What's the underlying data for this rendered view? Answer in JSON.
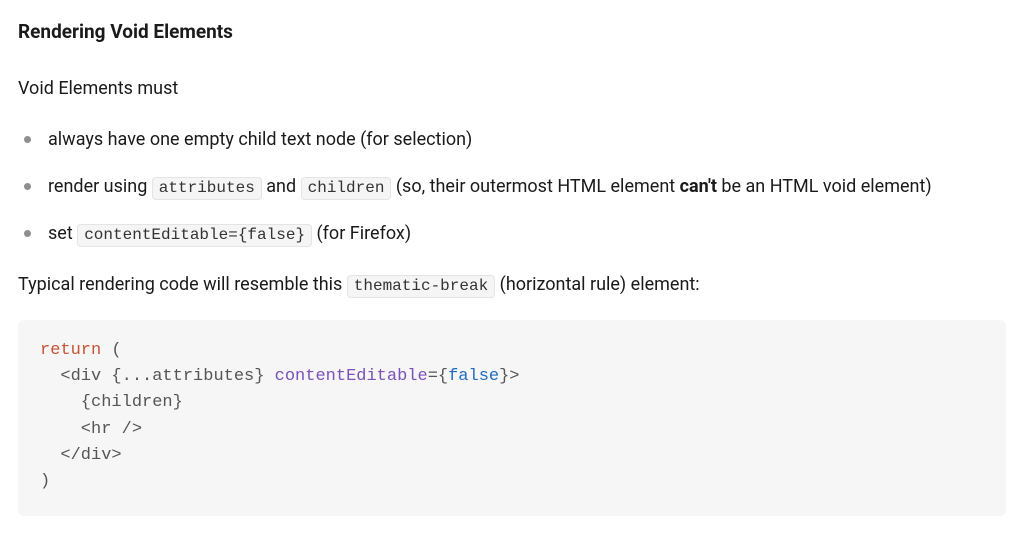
{
  "heading": "Rendering Void Elements",
  "intro": "Void Elements must",
  "bullets": {
    "b1": "always have one empty child text node (for selection)",
    "b2_before": "render using ",
    "b2_code1": "attributes",
    "b2_mid": " and ",
    "b2_code2": "children",
    "b2_after_1": " (so, their outermost HTML element ",
    "b2_bold": "can't",
    "b2_after_2": " be an HTML void element)",
    "b3_before": "set ",
    "b3_code": "contentEditable={false}",
    "b3_after": " (for Firefox)"
  },
  "lead": {
    "before": "Typical rendering code will resemble this ",
    "code": "thematic-break",
    "after": " (horizontal rule) element:"
  },
  "code": {
    "kw_return": "return",
    "open_paren": " (",
    "line2_open": "  <div ",
    "line2_spread": "{...attributes}",
    "space": " ",
    "attr_ce": "contentEditable",
    "eq": "=",
    "brace_open": "{",
    "bool_false": "false",
    "brace_close_gt": "}>",
    "line3": "    {children}",
    "line4": "    <hr />",
    "line5": "  </div>",
    "close_paren": ")"
  }
}
